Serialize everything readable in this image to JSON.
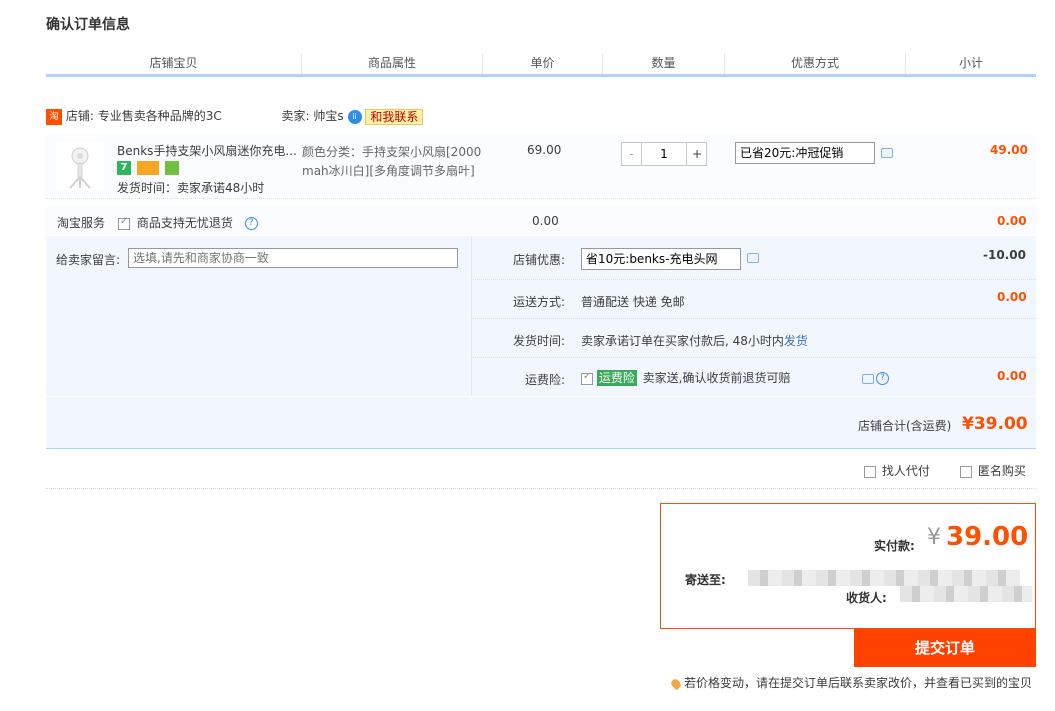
{
  "page": {
    "title": "确认订单信息"
  },
  "columns": [
    "店铺宝贝",
    "商品属性",
    "单价",
    "数量",
    "优惠方式",
    "小计"
  ],
  "shop": {
    "label": "店铺:",
    "name": "专业售卖各种品牌的3C",
    "seller_label": "卖家:",
    "seller": "帅宝s",
    "contact": "和我联系"
  },
  "item": {
    "title": "Benks手持支架小风扇迷你充电...",
    "attr_line1": "颜色分类：手持支架小风扇[2000",
    "attr_line2": "mah冰川白][多角度调节多扇叶]",
    "ship_time": "发货时间：卖家承诺48小时",
    "price": "69.00",
    "quantity": "1",
    "minus": "-",
    "plus": "+",
    "promo": "已省20元:冲冠促销",
    "subtotal": "49.00"
  },
  "service": {
    "label": "淘宝服务",
    "option": "商品支持无忧退货",
    "price": "0.00",
    "subtotal": "0.00"
  },
  "message": {
    "label": "给卖家留言:",
    "placeholder": "选填,请先和商家协商一致"
  },
  "shop_discount": {
    "label": "店铺优惠:",
    "value": "省10元:benks-充电头网",
    "amount": "-10.00"
  },
  "shipping": {
    "label": "运送方式:",
    "value": "普通配送 快递 免邮",
    "amount": "0.00"
  },
  "delivery": {
    "label": "发货时间:",
    "value": "卖家承诺订单在买家付款后, 48小时内",
    "link": "发货"
  },
  "insurance": {
    "label": "运费险:",
    "badge": "运费险",
    "value": "卖家送,确认收货前退货可赔",
    "amount": "0.00"
  },
  "shop_total": {
    "label": "店铺合计(含运费)",
    "amount": "¥39.00"
  },
  "options": {
    "proxy_pay": "找人代付",
    "anonymous": "匿名购买"
  },
  "payment": {
    "label": "实付款:",
    "currency": "¥",
    "amount": "39.00",
    "address_label": "寄送至:",
    "receiver_label": "收货人:"
  },
  "submit_label": "提交订单",
  "tip": "若价格变动，请在提交订单后联系卖家改价，并查看已买到的宝贝",
  "colors": {
    "accent": "#ff5000",
    "header_line": "#b2d1ff",
    "panel_bg": "#f2f7ff",
    "link": "#3d6fb6"
  }
}
